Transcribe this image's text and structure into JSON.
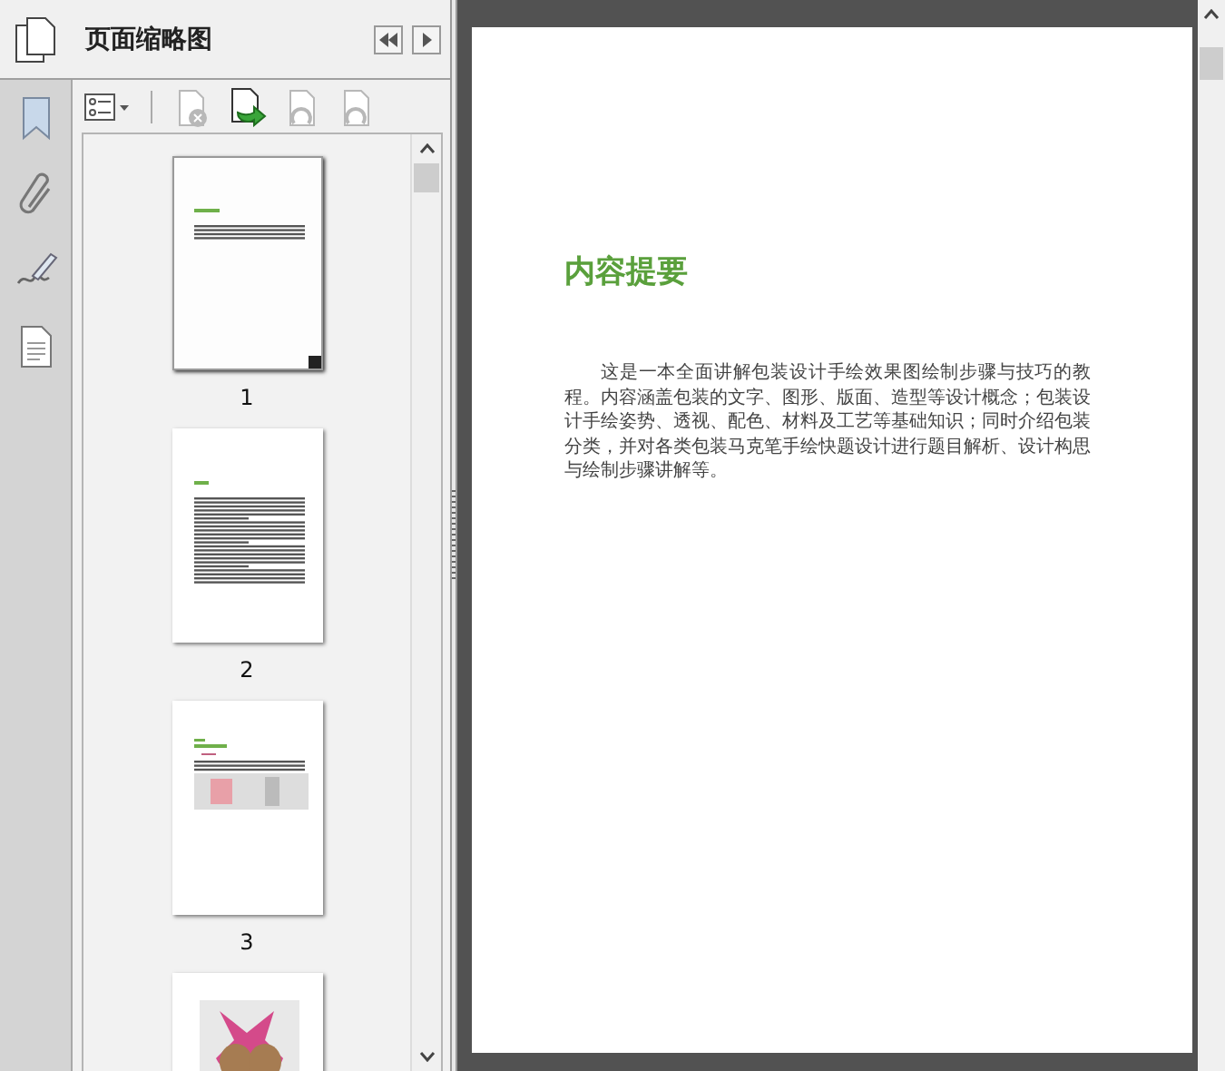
{
  "panel": {
    "title": "页面缩略图",
    "toolbar": [
      {
        "kind": "options",
        "disabled": false
      },
      {
        "kind": "delete",
        "disabled": true
      },
      {
        "kind": "insert",
        "disabled": false
      },
      {
        "kind": "undo",
        "disabled": true
      },
      {
        "kind": "redo",
        "disabled": true
      }
    ]
  },
  "thumbnails": [
    {
      "label": "1",
      "kind": "text",
      "selected": true
    },
    {
      "label": "2",
      "kind": "dense",
      "selected": false
    },
    {
      "label": "3",
      "kind": "images",
      "selected": false
    },
    {
      "kind": "photo",
      "selected": false
    }
  ],
  "page": {
    "heading": "内容提要",
    "body": "这是一本全面讲解包装设计手绘效果图绘制步骤与技巧的教程。内容涵盖包装的文字、图形、版面、造型等设计概念；包装设计手绘姿势、透视、配色、材料及工艺等基础知识；同时介绍包装分类，并对各类包装马克笔手绘快题设计进行题目解析、设计构思与绘制步骤讲解等。"
  }
}
